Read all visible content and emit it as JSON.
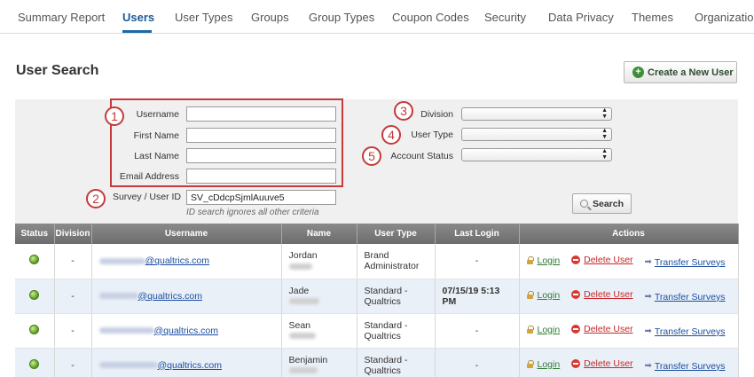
{
  "nav": {
    "tabs": [
      {
        "label": "Summary Report"
      },
      {
        "label": "Users"
      },
      {
        "label": "User Types"
      },
      {
        "label": "Groups"
      },
      {
        "label": "Group Types"
      },
      {
        "label": "Coupon Codes"
      },
      {
        "label": "Security"
      },
      {
        "label": "Data Privacy"
      },
      {
        "label": "Themes"
      },
      {
        "label": "Organization"
      }
    ],
    "active_tab": "Users"
  },
  "header": {
    "title": "User Search",
    "create_button_label": "Create a New User"
  },
  "search": {
    "labels": {
      "username": "Username",
      "first_name": "First Name",
      "last_name": "Last Name",
      "email": "Email Address",
      "survey_user_id": "Survey / User ID",
      "division": "Division",
      "user_type": "User Type",
      "account_status": "Account Status"
    },
    "values": {
      "username": "",
      "first_name": "",
      "last_name": "",
      "email": "",
      "survey_user_id": "SV_cDdcpSjmlAuuve5",
      "division": "",
      "user_type": "",
      "account_status": ""
    },
    "hint": "ID search ignores all other criteria",
    "search_button_label": "Search",
    "callouts": [
      "1",
      "2",
      "3",
      "4",
      "5"
    ]
  },
  "table": {
    "columns": [
      "Status",
      "Division",
      "Username",
      "Name",
      "User Type",
      "Last Login",
      "Actions"
    ],
    "rows": [
      {
        "division": "-",
        "email_domain": "@qualtrics.com",
        "first_name": "Jordan",
        "user_type": "Brand Administrator",
        "last_login": "-"
      },
      {
        "division": "-",
        "email_domain": "@qualtrics.com",
        "first_name": "Jade",
        "user_type": "Standard - Qualtrics",
        "last_login": "07/15/19 5:13 PM"
      },
      {
        "division": "-",
        "email_domain": "@qualtrics.com",
        "first_name": "Sean",
        "user_type": "Standard - Qualtrics",
        "last_login": "-"
      },
      {
        "division": "-",
        "email_domain": "@qualtrics.com",
        "first_name": "Benjamin",
        "user_type": "Standard - Qualtrics",
        "last_login": "-"
      }
    ],
    "actions": {
      "login": "Login",
      "delete": "Delete User",
      "transfer": "Transfer Surveys"
    }
  },
  "colors": {
    "accent": "#1a6aa8",
    "callout": "#c53a3a",
    "active_status": "#5a9a1e"
  }
}
